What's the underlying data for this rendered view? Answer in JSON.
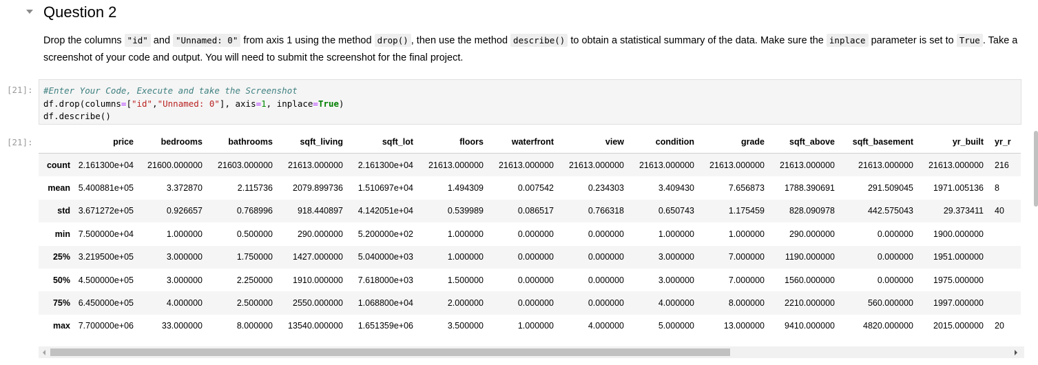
{
  "cell": {
    "heading": "Question 2",
    "instructions": [
      {
        "t": "text",
        "v": "Drop the columns "
      },
      {
        "t": "code",
        "v": "\"id\""
      },
      {
        "t": "text",
        "v": " and "
      },
      {
        "t": "code",
        "v": "\"Unnamed: 0\""
      },
      {
        "t": "text",
        "v": " from axis 1 using the method "
      },
      {
        "t": "code",
        "v": "drop()"
      },
      {
        "t": "text",
        "v": ", then use the method "
      },
      {
        "t": "code",
        "v": "describe()"
      },
      {
        "t": "text",
        "v": " to obtain a statistical summary of the data. Make sure the "
      },
      {
        "t": "code",
        "v": "inplace"
      },
      {
        "t": "text",
        "v": " parameter is set to "
      },
      {
        "t": "code",
        "v": "True"
      },
      {
        "t": "text",
        "v": ". Take a screenshot of your code and output. You will need to submit the screenshot for the final project."
      }
    ]
  },
  "input": {
    "prompt": "[21]:",
    "comment": "#Enter Your Code, Execute and take the Screenshot",
    "line2": {
      "p1": "df",
      "p2": ".",
      "p3": "drop(columns",
      "p4": "=",
      "p5": "[",
      "s1": "\"id\"",
      "p6": ",",
      "s2": "\"Unnamed: 0\"",
      "p7": "], axis",
      "p8": "=",
      "n1": "1",
      "p9": ", inplace",
      "p10": "=",
      "k1": "True",
      "p11": ")"
    },
    "line3": {
      "p1": "df",
      "p2": ".",
      "p3": "describe()"
    }
  },
  "output": {
    "prompt": "[21]:",
    "columns": [
      "",
      "price",
      "bedrooms",
      "bathrooms",
      "sqft_living",
      "sqft_lot",
      "floors",
      "waterfront",
      "view",
      "condition",
      "grade",
      "sqft_above",
      "sqft_basement",
      "yr_built",
      "yr_r"
    ],
    "rows": [
      [
        "count",
        "2.161300e+04",
        "21600.000000",
        "21603.000000",
        "21613.000000",
        "2.161300e+04",
        "21613.000000",
        "21613.000000",
        "21613.000000",
        "21613.000000",
        "21613.000000",
        "21613.000000",
        "21613.000000",
        "21613.000000",
        "216"
      ],
      [
        "mean",
        "5.400881e+05",
        "3.372870",
        "2.115736",
        "2079.899736",
        "1.510697e+04",
        "1.494309",
        "0.007542",
        "0.234303",
        "3.409430",
        "7.656873",
        "1788.390691",
        "291.509045",
        "1971.005136",
        "8"
      ],
      [
        "std",
        "3.671272e+05",
        "0.926657",
        "0.768996",
        "918.440897",
        "4.142051e+04",
        "0.539989",
        "0.086517",
        "0.766318",
        "0.650743",
        "1.175459",
        "828.090978",
        "442.575043",
        "29.373411",
        "40"
      ],
      [
        "min",
        "7.500000e+04",
        "1.000000",
        "0.500000",
        "290.000000",
        "5.200000e+02",
        "1.000000",
        "0.000000",
        "0.000000",
        "1.000000",
        "1.000000",
        "290.000000",
        "0.000000",
        "1900.000000",
        ""
      ],
      [
        "25%",
        "3.219500e+05",
        "3.000000",
        "1.750000",
        "1427.000000",
        "5.040000e+03",
        "1.000000",
        "0.000000",
        "0.000000",
        "3.000000",
        "7.000000",
        "1190.000000",
        "0.000000",
        "1951.000000",
        ""
      ],
      [
        "50%",
        "4.500000e+05",
        "3.000000",
        "2.250000",
        "1910.000000",
        "7.618000e+03",
        "1.500000",
        "0.000000",
        "0.000000",
        "3.000000",
        "7.000000",
        "1560.000000",
        "0.000000",
        "1975.000000",
        ""
      ],
      [
        "75%",
        "6.450000e+05",
        "4.000000",
        "2.500000",
        "2550.000000",
        "1.068800e+04",
        "2.000000",
        "0.000000",
        "0.000000",
        "4.000000",
        "8.000000",
        "2210.000000",
        "560.000000",
        "1997.000000",
        ""
      ],
      [
        "max",
        "7.700000e+06",
        "33.000000",
        "8.000000",
        "13540.000000",
        "1.651359e+06",
        "3.500000",
        "1.000000",
        "4.000000",
        "5.000000",
        "13.000000",
        "9410.000000",
        "4820.000000",
        "2015.000000",
        "20"
      ]
    ]
  },
  "icons": {
    "collapse": "caret-down-icon",
    "scroll_left": "arrow-left-icon",
    "scroll_right": "arrow-right-icon"
  },
  "colors": {
    "cell_bg": "#f5f5f5",
    "prompt": "#9a9a9a",
    "comment": "#408080",
    "string": "#ba2121",
    "keyword": "#008000"
  }
}
